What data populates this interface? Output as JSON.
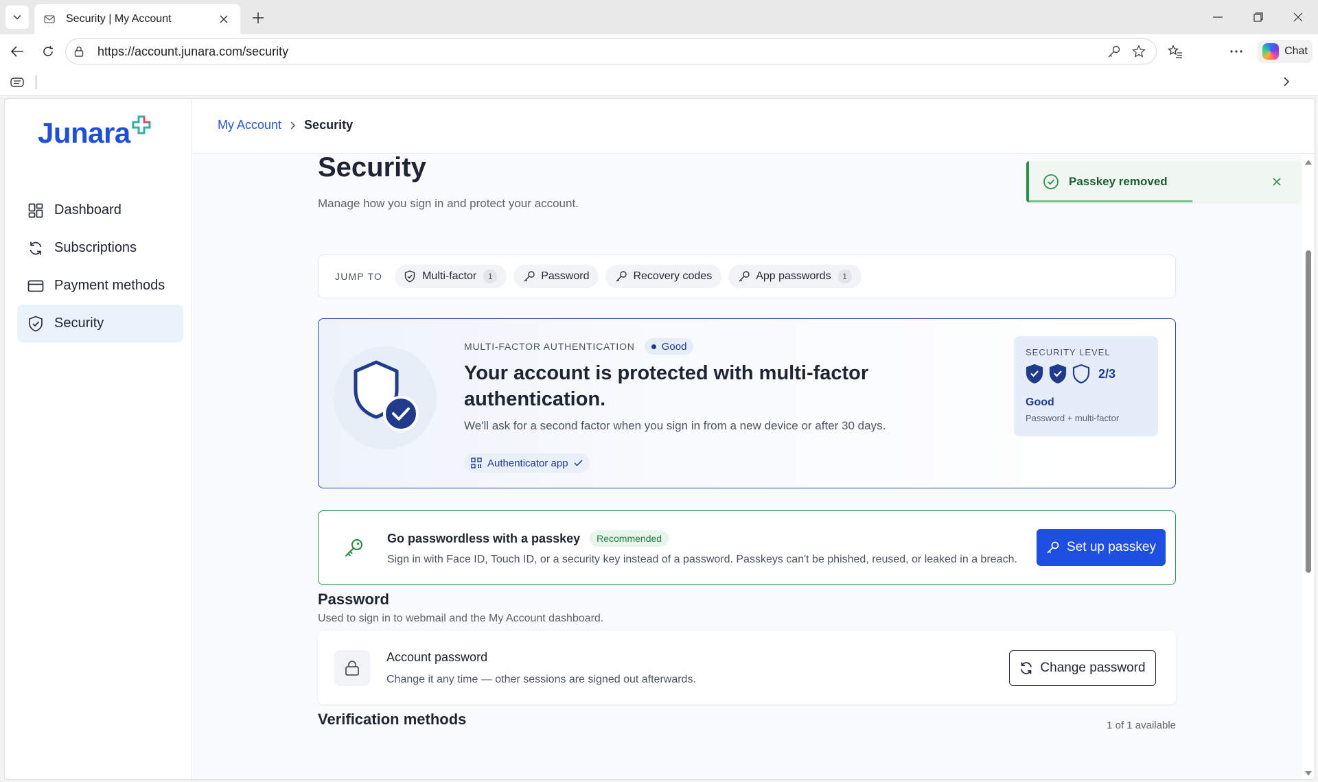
{
  "browser": {
    "tab_title": "Security | My Account",
    "url": "https://account.junara.com/security",
    "chat_label": "Chat"
  },
  "sidebar": {
    "logo_text": "Junara",
    "items": [
      {
        "label": "Dashboard",
        "icon": "dashboard-icon"
      },
      {
        "label": "Subscriptions",
        "icon": "refresh-icon"
      },
      {
        "label": "Payment methods",
        "icon": "card-icon"
      },
      {
        "label": "Security",
        "icon": "shield-icon",
        "active": true
      }
    ]
  },
  "breadcrumb": {
    "parent": "My Account",
    "current": "Security"
  },
  "header": {
    "title": "Security",
    "subtitle": "Manage how you sign in and protect your account."
  },
  "toast": {
    "message": "Passkey removed",
    "progress": 0.6
  },
  "jump": {
    "label": "JUMP TO",
    "chips": [
      {
        "label": "Multi-factor",
        "count": "1",
        "icon": "shield-icon"
      },
      {
        "label": "Password",
        "icon": "key-icon"
      },
      {
        "label": "Recovery codes",
        "icon": "key-icon"
      },
      {
        "label": "App passwords",
        "count": "1",
        "icon": "key-icon"
      }
    ]
  },
  "mfa": {
    "kicker": "MULTI-FACTOR AUTHENTICATION",
    "status": "Good",
    "heading": "Your account is protected with multi-factor authentication.",
    "description": "We'll ask for a second factor when you sign in from a new device or after 30 days.",
    "method": "Authenticator app",
    "level": {
      "title": "SECURITY LEVEL",
      "count": "2/3",
      "filled": 2,
      "total": 3,
      "status": "Good",
      "detail": "Password + multi-factor"
    }
  },
  "passkey": {
    "title": "Go passwordless with a passkey",
    "badge": "Recommended",
    "description": "Sign in with Face ID, Touch ID, or a security key instead of a password. Passkeys can't be phished, reused, or leaked in a breach.",
    "button": "Set up passkey"
  },
  "password_section": {
    "title": "Password",
    "subtitle": "Used to sign in to webmail and the My Account dashboard.",
    "card_title": "Account password",
    "card_desc": "Change it any time — other sessions are signed out afterwards.",
    "button": "Change password"
  },
  "verification": {
    "title": "Verification methods",
    "count": "1 of 1 available"
  },
  "colors": {
    "brand": "#1e4fd6",
    "navy": "#1f3b8a",
    "success": "#2f8f4e"
  }
}
